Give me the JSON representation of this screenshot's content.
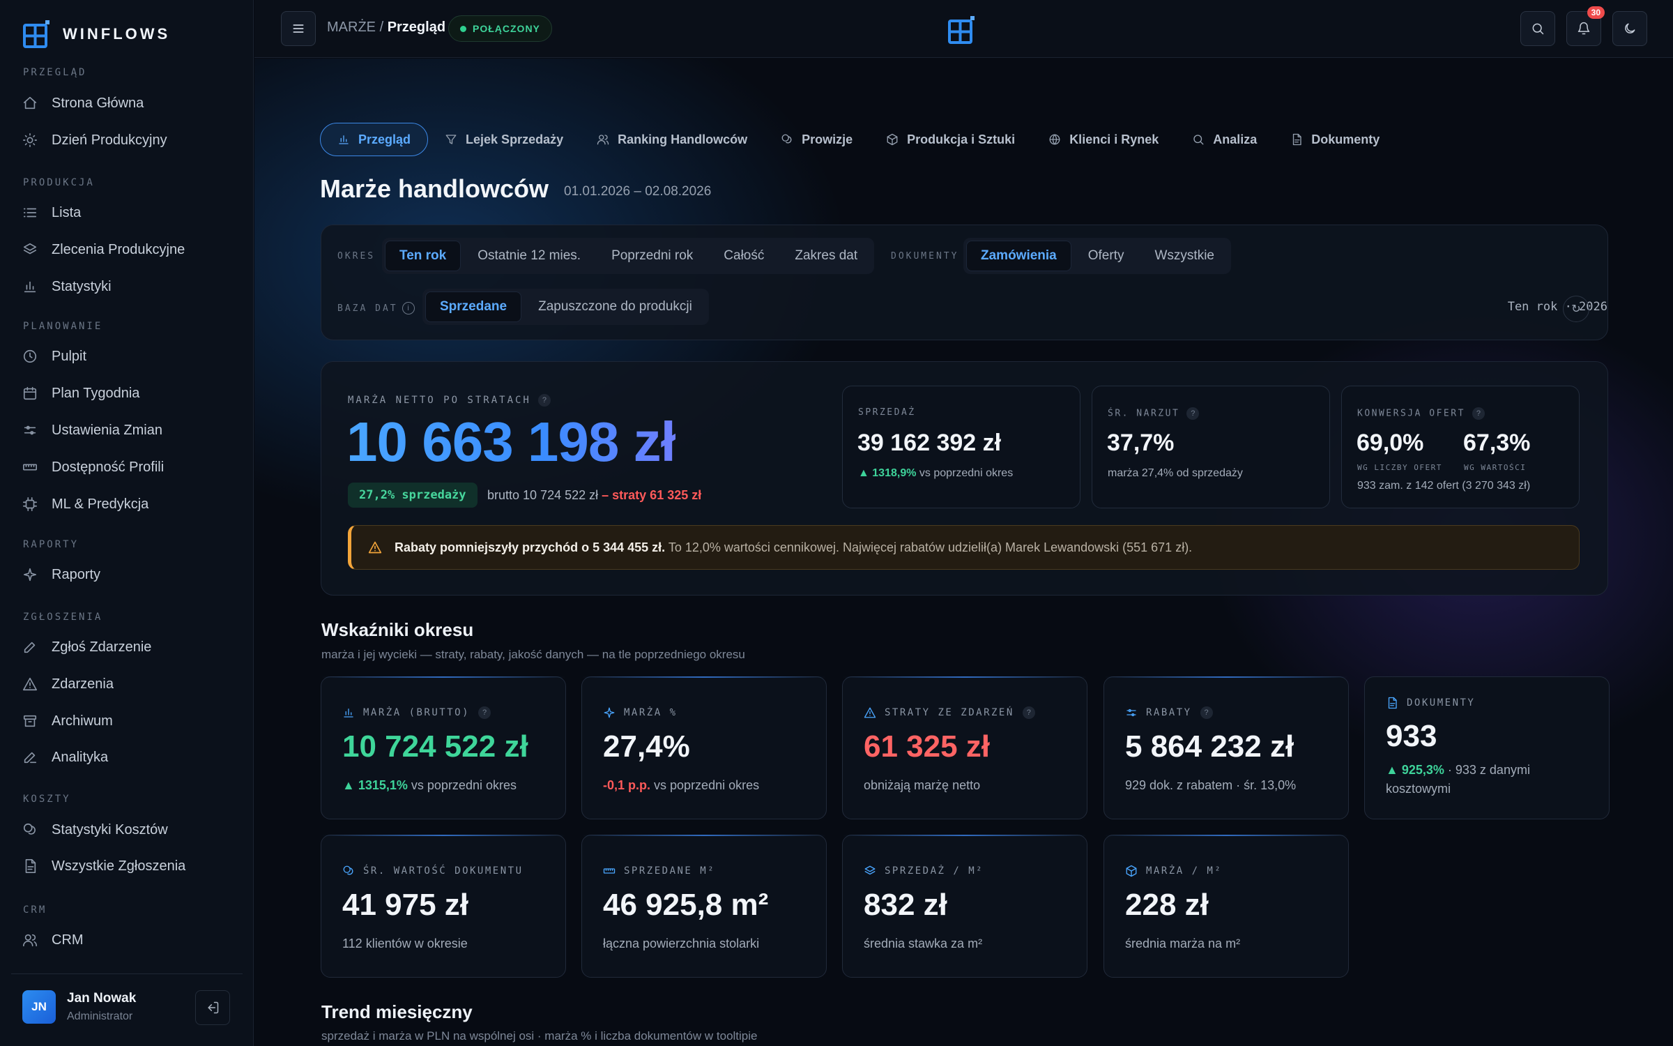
{
  "brand": {
    "name": "WINFLOWS"
  },
  "sidebar": {
    "sections": [
      {
        "title": "PRZEGLĄD",
        "items": [
          {
            "label": "Strona Główna",
            "icon": "home-icon"
          },
          {
            "label": "Dzień Produkcyjny",
            "icon": "sun-icon"
          }
        ]
      },
      {
        "title": "PRODUKCJA",
        "items": [
          {
            "label": "Lista",
            "icon": "list-icon"
          },
          {
            "label": "Zlecenia Produkcyjne",
            "icon": "layers-icon"
          },
          {
            "label": "Statystyki",
            "icon": "bar-chart-icon"
          }
        ]
      },
      {
        "title": "PLANOWANIE",
        "items": [
          {
            "label": "Pulpit",
            "icon": "clock-icon"
          },
          {
            "label": "Plan Tygodnia",
            "icon": "calendar-icon"
          },
          {
            "label": "Ustawienia Zmian",
            "icon": "sliders-icon"
          },
          {
            "label": "Dostępność Profili",
            "icon": "ruler-icon"
          },
          {
            "label": "ML & Predykcja",
            "icon": "cpu-icon"
          }
        ]
      },
      {
        "title": "RAPORTY",
        "items": [
          {
            "label": "Raporty",
            "icon": "sparkle-icon"
          }
        ]
      },
      {
        "title": "ZGŁOSZENIA",
        "items": [
          {
            "label": "Zgłoś Zdarzenie",
            "icon": "pen-icon"
          },
          {
            "label": "Zdarzenia",
            "icon": "alert-triangle-icon"
          },
          {
            "label": "Archiwum",
            "icon": "archive-icon"
          },
          {
            "label": "Analityka",
            "icon": "pen-line-icon"
          }
        ]
      },
      {
        "title": "KOSZTY",
        "items": [
          {
            "label": "Statystyki Kosztów",
            "icon": "coins-icon"
          },
          {
            "label": "Wszystkie Zgłoszenia",
            "icon": "file-icon"
          }
        ]
      },
      {
        "title": "CRM",
        "items": [
          {
            "label": "CRM",
            "icon": "users-icon"
          }
        ]
      }
    ]
  },
  "user": {
    "initials": "JN",
    "name": "Jan Nowak",
    "role": "Administrator"
  },
  "topbar": {
    "crumb_parent": "MARŻE",
    "crumb_sep": "/",
    "crumb_current": "Przegląd",
    "status": "POŁĄCZONY",
    "notifications": "30"
  },
  "tabs": [
    {
      "label": "Przegląd",
      "icon": "bar-chart-icon",
      "active": true
    },
    {
      "label": "Lejek Sprzedaży",
      "icon": "filter-icon"
    },
    {
      "label": "Ranking Handlowców",
      "icon": "users-icon"
    },
    {
      "label": "Prowizje",
      "icon": "coins-icon"
    },
    {
      "label": "Produkcja i Sztuki",
      "icon": "box-icon"
    },
    {
      "label": "Klienci i Rynek",
      "icon": "globe-icon"
    },
    {
      "label": "Analiza",
      "icon": "search-icon"
    },
    {
      "label": "Dokumenty",
      "icon": "file-icon"
    }
  ],
  "page": {
    "title": "Marże handlowców",
    "dates": "01.01.2026 – 02.08.2026"
  },
  "filters": {
    "period_label": "OKRES",
    "period_options": [
      "Ten rok",
      "Ostatnie 12 mies.",
      "Poprzedni rok",
      "Całość",
      "Zakres dat"
    ],
    "period_selected": "Ten rok",
    "docs_label": "DOKUMENTY",
    "docs_options": [
      "Zamówienia",
      "Oferty",
      "Wszystkie"
    ],
    "docs_selected": "Zamówienia",
    "base_label": "BAZA DAT",
    "base_options": [
      "Sprzedane",
      "Zapuszczone do produkcji"
    ],
    "base_selected": "Sprzedane",
    "summary": "Ten rok · 2026"
  },
  "hero": {
    "label": "MARŻA NETTO PO STRATACH",
    "value": "10 663 198 zł",
    "pill": "27,2% sprzedaży",
    "sub_prefix": "brutto 10 724 522 zł",
    "sub_loss": "– straty 61 325 zł",
    "stats": [
      {
        "label": "SPRZEDAŻ",
        "value": "39 162 392 zł",
        "delta": "▲ 1318,9%",
        "sub": "vs poprzedni okres"
      },
      {
        "label": "ŚR. NARZUT",
        "value": "37,7%",
        "sub": "marża 27,4% od sprzedaży"
      },
      {
        "label": "KONWERSJA OFERT",
        "value_a": "69,0%",
        "cap_a": "WG LICZBY OFERT",
        "value_b": "67,3%",
        "cap_b": "WG WARTOŚCI",
        "sub": "933 zam. z 142 ofert (3 270 343 zł)"
      }
    ],
    "warning_bold": "Rabaty pomniejszyły przychód o 5 344 455 zł.",
    "warning_text": "To 12,0% wartości cennikowej. Najwięcej rabatów udzielił(a) Marek Lewandowski (551 671 zł)."
  },
  "indicators": {
    "title": "Wskaźniki okresu",
    "subtitle": "marża i jej wycieki — straty, rabaty, jakość danych — na tle poprzedniego okresu",
    "cards": [
      {
        "label": "MARŻA (BRUTTO)",
        "icon": "bar-chart-icon",
        "value": "10 724 522 zł",
        "delta": "▲ 1315,1%",
        "sub": "vs poprzedni okres",
        "color": "#3fd69a"
      },
      {
        "label": "MARŻA %",
        "icon": "sparkle-icon",
        "value": "27,4%",
        "delta": "-0,1 p.p.",
        "sub": "vs poprzedni okres",
        "color": "#f2f5f9"
      },
      {
        "label": "STRATY ZE ZDARZEŃ",
        "icon": "alert-triangle-icon",
        "value": "61 325 zł",
        "sub": "obniżają marżę netto",
        "color": "#ff6464"
      },
      {
        "label": "RABATY",
        "icon": "sliders-icon",
        "value": "5 864 232 zł",
        "sub": "929 dok. z rabatem · śr. 13,0%",
        "color": "#f2f5f9"
      },
      {
        "label": "DOKUMENTY",
        "icon": "file-icon",
        "value": "933",
        "delta": "▲ 925,3%",
        "sub": "· 933 z danymi kosztowymi",
        "color": "#f2f5f9"
      },
      {
        "label": "ŚR. WARTOŚĆ DOKUMENTU",
        "icon": "coins-icon",
        "value": "41 975 zł",
        "sub": "112 klientów w okresie"
      },
      {
        "label": "SPRZEDANE M²",
        "icon": "ruler-icon",
        "value": "46 925,8 m²",
        "sub": "łączna powierzchnia stolarki"
      },
      {
        "label": "SPRZEDAŻ / M²",
        "icon": "layers-icon",
        "value": "832 zł",
        "sub": "średnia stawka za m²"
      },
      {
        "label": "MARŻA / M²",
        "icon": "box-icon",
        "value": "228 zł",
        "sub": "średnia marża na m²"
      }
    ]
  },
  "trend": {
    "title": "Trend miesięczny",
    "subtitle": "sprzedaż i marża w PLN na wspólnej osi · marża % i liczba dokumentów w tooltipie"
  },
  "colors": {
    "accent": "#3d9bff",
    "positive": "#3ed39a",
    "negative": "#ff5a5a",
    "warning": "#f3a53a",
    "background": "#070b13"
  }
}
